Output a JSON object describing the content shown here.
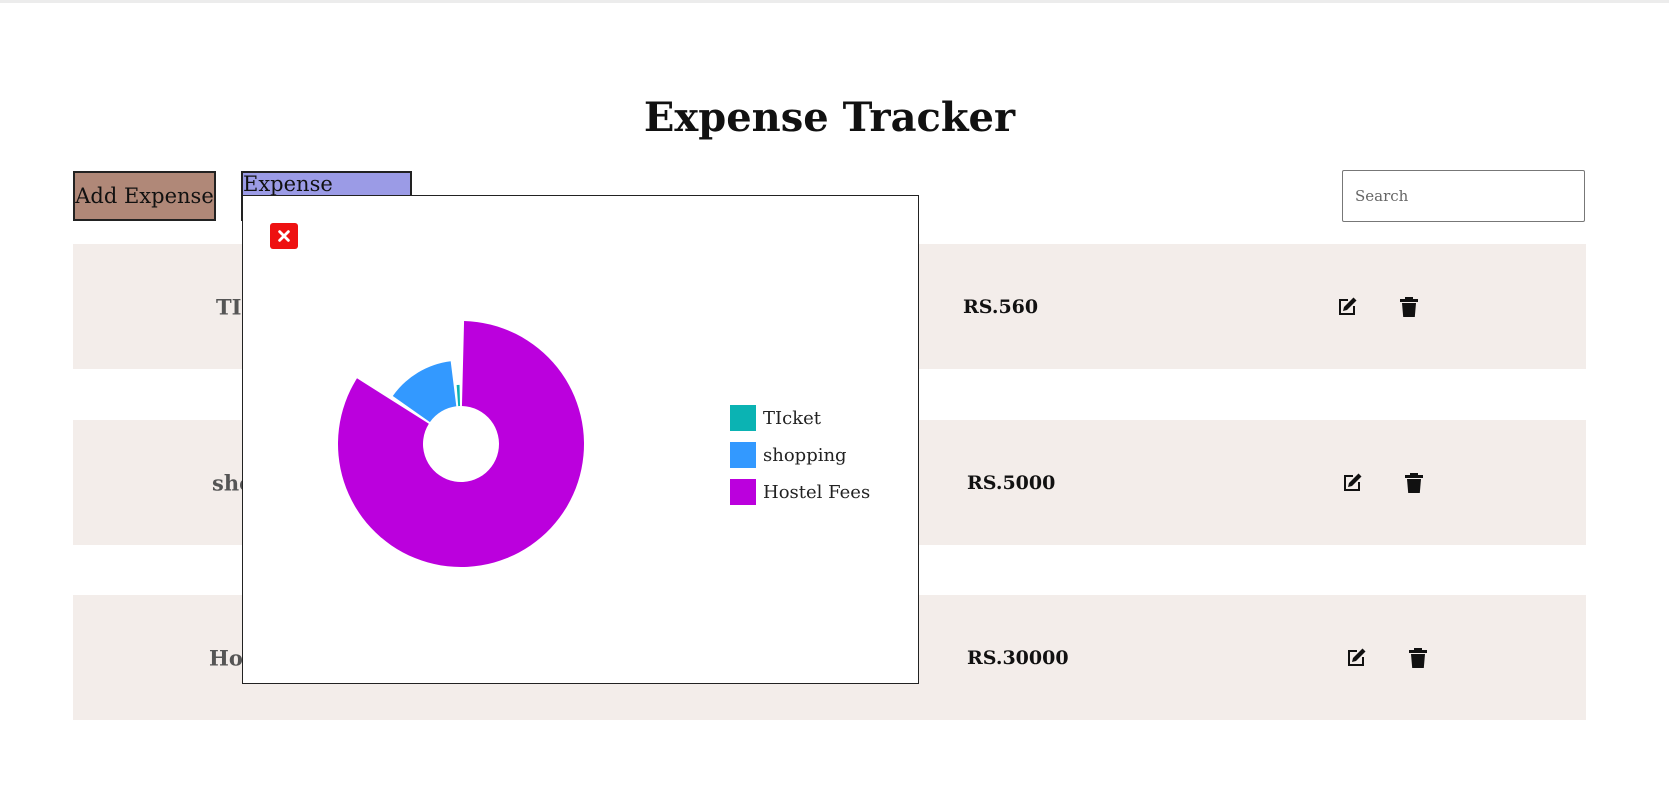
{
  "header": {
    "title": "Expense Tracker"
  },
  "toolbar": {
    "add_label": "Add Expense",
    "add_color": "#b08878",
    "report_label": "Expense Report",
    "report_color": "#9b9be6",
    "search_placeholder": "Search"
  },
  "rows": [
    {
      "name": "TIcket",
      "amount": "RS.560"
    },
    {
      "name": "shopping",
      "amount": "RS.5000"
    },
    {
      "name": "Hostel Fees",
      "amount": "RS.30000"
    }
  ],
  "modal": {
    "close_icon": "close-x-icon",
    "chart_data": {
      "type": "pie",
      "categories": [
        "TIcket",
        "shopping",
        "Hostel Fees"
      ],
      "values": [
        560,
        5000,
        30000
      ],
      "colors": [
        "#0bb3b3",
        "#3399ff",
        "#bb00dd"
      ],
      "legend": "right"
    }
  },
  "icons": {
    "edit": "edit-icon",
    "delete": "trash-icon"
  }
}
